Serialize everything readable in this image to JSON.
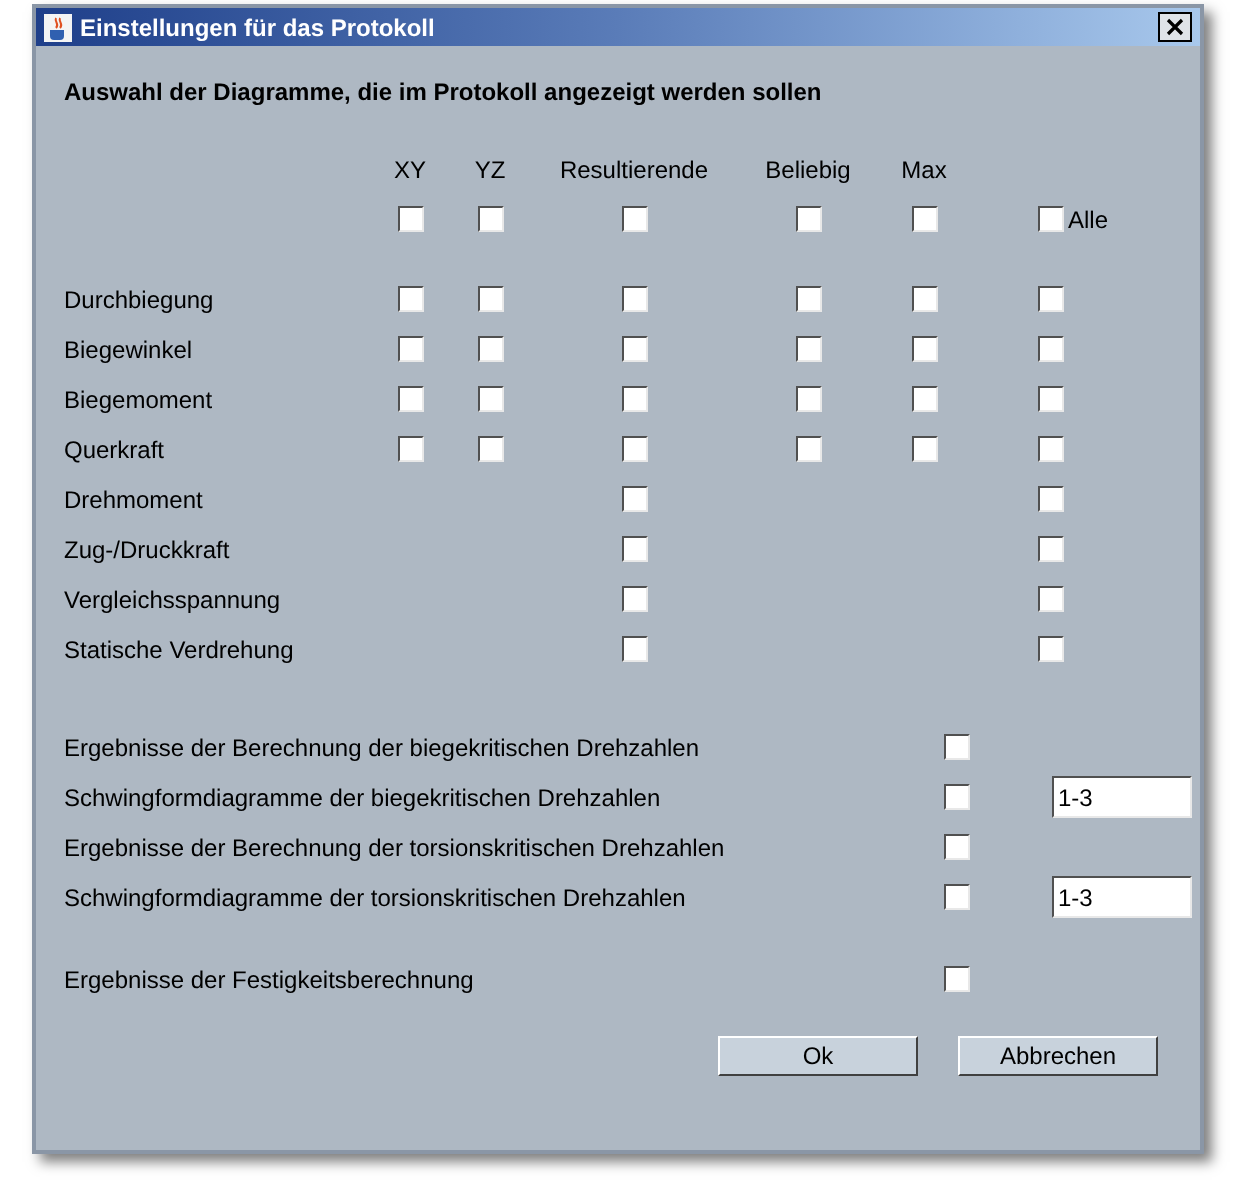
{
  "window": {
    "title": "Einstellungen für das Protokoll"
  },
  "heading": "Auswahl der Diagramme, die im Protokoll angezeigt werden sollen",
  "columns": [
    {
      "label": "XY",
      "checked": false
    },
    {
      "label": "YZ",
      "checked": false
    },
    {
      "label": "Resultierende",
      "checked": false
    },
    {
      "label": "Beliebig",
      "checked": false
    },
    {
      "label": "Max",
      "checked": false
    }
  ],
  "select_all": {
    "label": "Alle",
    "checked": false
  },
  "rows": [
    {
      "label": "Durchbiegung",
      "cells": [
        {
          "kind": "checkbox",
          "checked": false
        },
        {
          "kind": "checkbox",
          "checked": false
        },
        {
          "kind": "checkbox",
          "checked": false
        },
        {
          "kind": "checkbox",
          "checked": false
        },
        {
          "kind": "checkbox",
          "checked": false
        },
        {
          "kind": "checkbox",
          "checked": false
        }
      ]
    },
    {
      "label": "Biegewinkel",
      "cells": [
        {
          "kind": "checkbox",
          "checked": false
        },
        {
          "kind": "checkbox",
          "checked": false
        },
        {
          "kind": "checkbox",
          "checked": false
        },
        {
          "kind": "checkbox",
          "checked": false
        },
        {
          "kind": "checkbox",
          "checked": false
        },
        {
          "kind": "checkbox",
          "checked": false
        }
      ]
    },
    {
      "label": "Biegemoment",
      "cells": [
        {
          "kind": "checkbox",
          "checked": false
        },
        {
          "kind": "checkbox",
          "checked": false
        },
        {
          "kind": "checkbox",
          "checked": false
        },
        {
          "kind": "checkbox",
          "checked": false
        },
        {
          "kind": "checkbox",
          "checked": false
        },
        {
          "kind": "checkbox",
          "checked": false
        }
      ]
    },
    {
      "label": "Querkraft",
      "cells": [
        {
          "kind": "checkbox",
          "checked": false
        },
        {
          "kind": "checkbox",
          "checked": false
        },
        {
          "kind": "checkbox",
          "checked": false
        },
        {
          "kind": "checkbox",
          "checked": false
        },
        {
          "kind": "checkbox",
          "checked": false
        },
        {
          "kind": "checkbox",
          "checked": false
        }
      ]
    },
    {
      "label": "Drehmoment",
      "cells": [
        {
          "kind": "empty"
        },
        {
          "kind": "empty"
        },
        {
          "kind": "checkbox",
          "checked": false
        },
        {
          "kind": "empty"
        },
        {
          "kind": "empty"
        },
        {
          "kind": "checkbox",
          "checked": false
        }
      ]
    },
    {
      "label": "Zug-/Druckkraft",
      "cells": [
        {
          "kind": "empty"
        },
        {
          "kind": "empty"
        },
        {
          "kind": "checkbox",
          "checked": false
        },
        {
          "kind": "empty"
        },
        {
          "kind": "empty"
        },
        {
          "kind": "checkbox",
          "checked": false
        }
      ]
    },
    {
      "label": "Vergleichsspannung",
      "cells": [
        {
          "kind": "empty"
        },
        {
          "kind": "empty"
        },
        {
          "kind": "checkbox",
          "checked": false
        },
        {
          "kind": "empty"
        },
        {
          "kind": "empty"
        },
        {
          "kind": "checkbox",
          "checked": false
        }
      ]
    },
    {
      "label": "Statische Verdrehung",
      "cells": [
        {
          "kind": "empty"
        },
        {
          "kind": "empty"
        },
        {
          "kind": "checkbox",
          "checked": false
        },
        {
          "kind": "empty"
        },
        {
          "kind": "empty"
        },
        {
          "kind": "checkbox",
          "checked": false
        }
      ]
    }
  ],
  "results": [
    {
      "label": "Ergebnisse der Berechnung der biegekritischen Drehzahlen",
      "checked": false
    },
    {
      "label": "Schwingformdiagramme der biegekritischen Drehzahlen",
      "checked": false,
      "range": "1-3"
    },
    {
      "label": "Ergebnisse der Berechnung der torsionskritischen Drehzahlen",
      "checked": false
    },
    {
      "label": "Schwingformdiagramme der torsionskritischen Drehzahlen",
      "checked": false,
      "range": "1-3"
    }
  ],
  "strength": {
    "label": "Ergebnisse der Festigkeitsberechnung",
    "checked": false
  },
  "buttons": [
    "Ok",
    "Abbrechen"
  ]
}
